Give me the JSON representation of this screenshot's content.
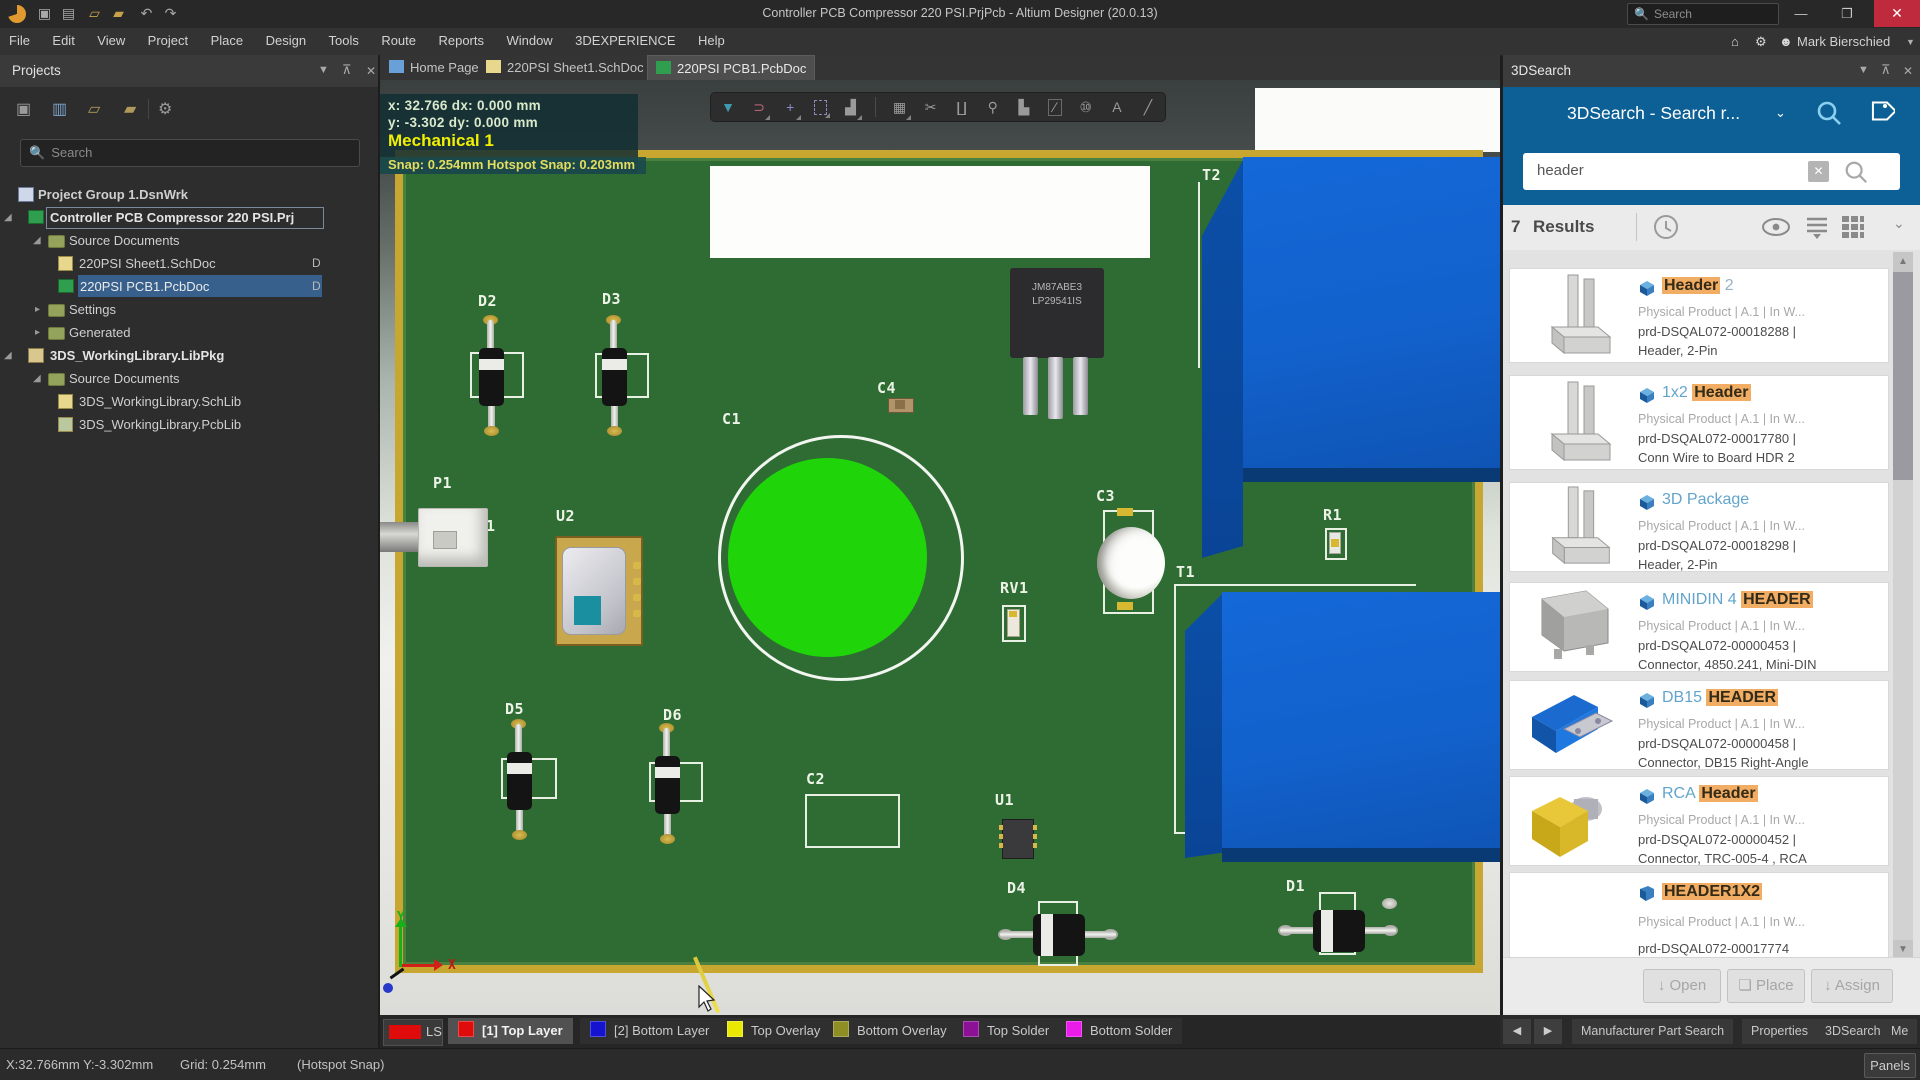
{
  "titlebar": {
    "title": "Controller PCB Compressor 220 PSI.PrjPcb - Altium Designer (20.0.13)",
    "search_placeholder": "Search"
  },
  "menubar": {
    "items": [
      "File",
      "Edit",
      "View",
      "Project",
      "Place",
      "Design",
      "Tools",
      "Route",
      "Reports",
      "Window",
      "3DEXPERIENCE",
      "Help"
    ],
    "user": "Mark Bierschied"
  },
  "projects_panel": {
    "title": "Projects",
    "search_placeholder": "Search",
    "tree": [
      {
        "label": "Project Group 1.DsnWrk"
      },
      {
        "label": "Controller PCB Compressor 220 PSI.Prj"
      },
      {
        "label": "Source Documents"
      },
      {
        "label": "220PSI Sheet1.SchDoc",
        "badge": "D"
      },
      {
        "label": "220PSI PCB1.PcbDoc",
        "badge": "D"
      },
      {
        "label": "Settings"
      },
      {
        "label": "Generated"
      },
      {
        "label": "3DS_WorkingLibrary.LibPkg"
      },
      {
        "label": "Source Documents"
      },
      {
        "label": "3DS_WorkingLibrary.SchLib"
      },
      {
        "label": "3DS_WorkingLibrary.PcbLib"
      }
    ]
  },
  "doc_tabs": [
    {
      "label": "Home Page"
    },
    {
      "label": "220PSI Sheet1.SchDoc"
    },
    {
      "label": "220PSI PCB1.PcbDoc"
    }
  ],
  "hud": {
    "line1": "x: 32.766   dx:  0.000 mm",
    "line2": "y: -3.302   dy:  0.000 mm",
    "layer": "Mechanical 1",
    "snap": "Snap: 0.254mm Hotspot Snap: 0.203mm"
  },
  "pcb": {
    "labels": {
      "d2": "D2",
      "d3": "D3",
      "c4": "C4",
      "c1": "C1",
      "p1": "P1",
      "p1_pin": "1",
      "u2": "U2",
      "c3": "C3",
      "rv1": "RV1",
      "t2": "T2",
      "t1": "T1",
      "r1": "R1",
      "u1": "U1",
      "d5": "D5",
      "d6": "D6",
      "c2": "C2",
      "d4": "D4",
      "d1": "D1"
    },
    "regulator_line1": "JM87ABE3",
    "regulator_line2": "LP29541IS",
    "axis_x": "X",
    "axis_y": "Y"
  },
  "layer_bar": {
    "ls": "LS",
    "tabs": [
      {
        "label": "[1] Top Layer",
        "color": "#e00c0c"
      },
      {
        "label": "[2] Bottom Layer",
        "color": "#1414d0"
      },
      {
        "label": "Top Overlay",
        "color": "#e8e800"
      },
      {
        "label": "Bottom Overlay",
        "color": "#8e8e24"
      },
      {
        "label": "Top Solder",
        "color": "#8c1196"
      },
      {
        "label": "Bottom Solder",
        "color": "#ea1cea"
      }
    ]
  },
  "search_panel": {
    "title": "3DSearch",
    "banner_title": "3DSearch - Search r...",
    "query": "header",
    "results_count": "7",
    "results_label": "Results",
    "results": [
      {
        "pre": "",
        "hl": "Header",
        "post": " 2",
        "line2": "Physical Product | A.1 | In W...",
        "line3": "prd-DSQAL072-00018288 |",
        "line4": "Header, 2-Pin"
      },
      {
        "pre": "1x2 ",
        "hl": "Header",
        "post": "",
        "line2": "Physical Product | A.1 | In W...",
        "line3": "prd-DSQAL072-00017780 |",
        "line4": "Conn Wire to Board HDR 2"
      },
      {
        "pre": "3D Package",
        "hl": "",
        "post": "",
        "line2": "Physical Product | A.1 | In W...",
        "line3": "prd-DSQAL072-00018298 |",
        "line4": "Header, 2-Pin"
      },
      {
        "pre": "MINIDIN 4 ",
        "hl": "HEADER",
        "post": "",
        "line2": "Physical Product | A.1 | In W...",
        "line3": "prd-DSQAL072-00000453 |",
        "line4": "Connector, 4850.241, Mini-DIN"
      },
      {
        "pre": "DB15 ",
        "hl": "HEADER",
        "post": "",
        "line2": "Physical Product | A.1 | In W...",
        "line3": "prd-DSQAL072-00000458 |",
        "line4": "Connector, DB15 Right-Angle"
      },
      {
        "pre": "RCA ",
        "hl": "Header",
        "post": "",
        "line2": "Physical Product | A.1 | In W...",
        "line3": "prd-DSQAL072-00000452 |",
        "line4": "Connector, TRC-005-4 , RCA"
      },
      {
        "pre": "",
        "hl": "HEADER1X2",
        "post": "",
        "line2": "Physical Product | A.1 | In W...",
        "line3": "prd-DSQAL072-00017774",
        "line4": ""
      }
    ],
    "buttons": [
      "Open",
      "Place",
      "Assign"
    ]
  },
  "bottom_tabs": {
    "tabs": [
      "Manufacturer Part Search",
      "Properties",
      "3DSearch",
      "Me"
    ]
  },
  "statusbar": {
    "coords": "X:32.766mm Y:-3.302mm",
    "grid": "Grid: 0.254mm",
    "snap": "(Hotspot Snap)",
    "panels": "Panels"
  }
}
